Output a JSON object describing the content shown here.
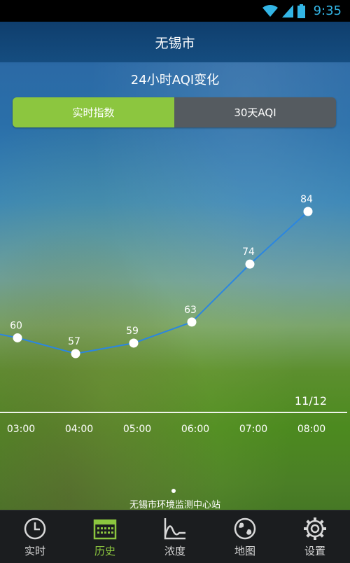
{
  "status_bar": {
    "time": "9:35"
  },
  "header": {
    "city": "无锡市"
  },
  "chart_title": "24小时AQI变化",
  "toggle": {
    "active_label": "实时指数",
    "inactive_label": "30天AQI"
  },
  "date_label": "11/12",
  "station": "无锡市环境监测中心站",
  "chart_data": {
    "type": "line",
    "title": "24小时AQI变化",
    "categories": [
      "03:00",
      "04:00",
      "05:00",
      "06:00",
      "07:00",
      "08:00"
    ],
    "values": [
      60,
      57,
      59,
      63,
      74,
      84
    ],
    "xlabel": "",
    "ylabel": "",
    "color": "#2b86e0",
    "grid": false
  },
  "tabs": [
    {
      "label": "实时",
      "icon": "clock-icon",
      "active": false
    },
    {
      "label": "历史",
      "icon": "calendar-icon",
      "active": true
    },
    {
      "label": "浓度",
      "icon": "concentration-chart-icon",
      "active": false
    },
    {
      "label": "地图",
      "icon": "map-globe-icon",
      "active": false
    },
    {
      "label": "设置",
      "icon": "gear-icon",
      "active": false
    }
  ],
  "colors": {
    "accent": "#8cc63f",
    "line": "#2b86e0",
    "header": "#154d80"
  }
}
